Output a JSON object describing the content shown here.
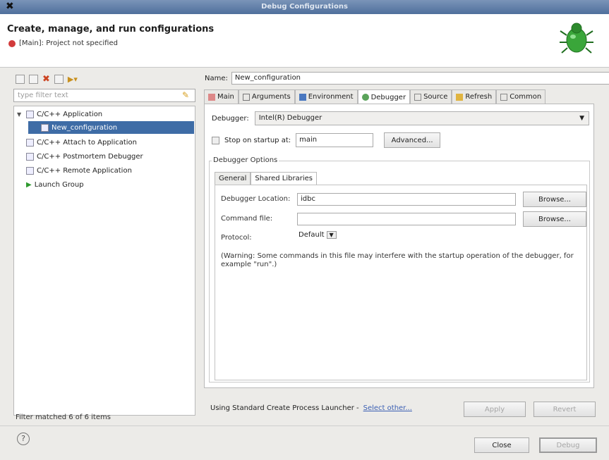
{
  "window": {
    "title": "Debug Configurations",
    "close_glyph": "✖"
  },
  "header": {
    "heading": "Create, manage, and run configurations",
    "error_text": "[Main]: Project not specified"
  },
  "left": {
    "filter_placeholder": "type filter text",
    "tree": [
      {
        "label": "C/C++ Application",
        "expanded": true
      },
      {
        "label": "New_configuration",
        "selected": true
      },
      {
        "label": "C/C++ Attach to Application"
      },
      {
        "label": "C/C++ Postmortem Debugger"
      },
      {
        "label": "C/C++ Remote Application"
      },
      {
        "label": "Launch Group"
      }
    ],
    "status": "Filter matched 6 of 6 items"
  },
  "right": {
    "name_label": "Name:",
    "name_value": "New_configuration",
    "tabs": [
      {
        "label": "Main",
        "icon": "main-tab-icon"
      },
      {
        "label": "Arguments",
        "icon": "arguments-tab-icon"
      },
      {
        "label": "Environment",
        "icon": "environment-tab-icon"
      },
      {
        "label": "Debugger",
        "icon": "debugger-tab-icon",
        "active": true
      },
      {
        "label": "Source",
        "icon": "source-tab-icon"
      },
      {
        "label": "Refresh",
        "icon": "refresh-tab-icon"
      },
      {
        "label": "Common",
        "icon": "common-tab-icon"
      }
    ],
    "debugger_label": "Debugger:",
    "debugger_value": "Intel(R) Debugger",
    "stop_label": "Stop on startup at:",
    "stop_value": "main",
    "advanced_label": "Advanced...",
    "options_title": "Debugger Options",
    "subtabs": [
      {
        "label": "General"
      },
      {
        "label": "Shared Libraries",
        "active": true
      }
    ],
    "location_label": "Debugger Location:",
    "location_value": "idbc",
    "command_label": "Command file:",
    "command_value": "",
    "browse1": "Browse...",
    "browse2": "Browse...",
    "protocol_label": "Protocol:",
    "protocol_value": "Default",
    "warning": "(Warning: Some commands in this file may interfere with the startup operation of the debugger, for example \"run\".)",
    "launcher_text": "Using Standard Create Process Launcher -",
    "select_other": "Select other...",
    "apply": "Apply",
    "revert": "Revert"
  },
  "footer": {
    "help_glyph": "?",
    "close": "Close",
    "debug": "Debug"
  },
  "colors": {
    "selection": "#3e6ca6",
    "error": "#d23b3b",
    "link": "#3b5fb3"
  }
}
